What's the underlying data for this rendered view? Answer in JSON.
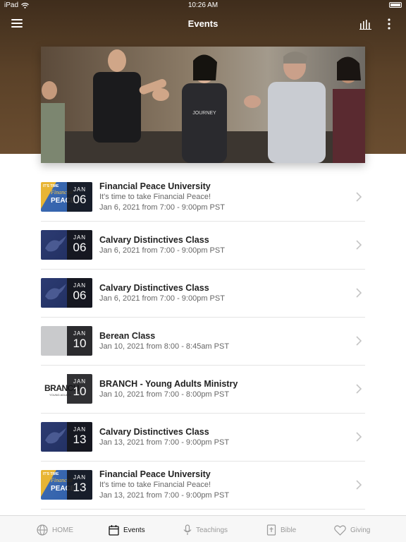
{
  "status_bar": {
    "device": "iPad",
    "time": "10:26 AM"
  },
  "nav": {
    "title": "Events"
  },
  "colors": {
    "header_brown": "#5a4128",
    "active_tab": "#111111",
    "inactive_tab": "#9a9a9a"
  },
  "events": [
    {
      "title": "Financial Peace University",
      "subtitle": "It's time to take Financial Peace!",
      "when": "Jan 6, 2021 from 7:00 - 9:00pm PST",
      "month": "JAN",
      "day": "06",
      "thumb": "financial-peace"
    },
    {
      "title": "Calvary Distinctives Class",
      "subtitle": "",
      "when": "Jan 6, 2021 from 7:00 - 9:00pm PST",
      "month": "JAN",
      "day": "06",
      "thumb": "calvary-dove"
    },
    {
      "title": "Calvary Distinctives Class",
      "subtitle": "",
      "when": "Jan 6, 2021 from 7:00 - 9:00pm PST",
      "month": "JAN",
      "day": "06",
      "thumb": "calvary-dove"
    },
    {
      "title": "Berean Class",
      "subtitle": "",
      "when": "Jan 10, 2021 from 8:00 - 8:45am PST",
      "month": "JAN",
      "day": "10",
      "thumb": "grey"
    },
    {
      "title": "BRANCH - Young Adults Ministry",
      "subtitle": "",
      "when": "Jan 10, 2021 from 7:00 - 8:00pm PST",
      "month": "JAN",
      "day": "10",
      "thumb": "branch"
    },
    {
      "title": "Calvary Distinctives Class",
      "subtitle": "",
      "when": "Jan 13, 2021 from 7:00 - 9:00pm PST",
      "month": "JAN",
      "day": "13",
      "thumb": "calvary-dove"
    },
    {
      "title": "Financial Peace University",
      "subtitle": "It's time to take Financial Peace!",
      "when": "Jan 13, 2021 from 7:00 - 9:00pm PST",
      "month": "JAN",
      "day": "13",
      "thumb": "financial-peace"
    }
  ],
  "thumb_text": {
    "fpu_top": "IT'S TIME",
    "fpu_mid": "Financial",
    "fpu_big": "PEACE",
    "branch": "BRANCH",
    "branch_sub": "YOUNG ADULTS",
    "hero_shirt": "JOURNEY"
  },
  "tabs": [
    {
      "label": "HOME",
      "icon": "globe-icon"
    },
    {
      "label": "Events",
      "icon": "calendar-icon",
      "active": true
    },
    {
      "label": "Teachings",
      "icon": "microphone-icon"
    },
    {
      "label": "Bible",
      "icon": "bible-icon"
    },
    {
      "label": "Giving",
      "icon": "heart-icon"
    }
  ]
}
